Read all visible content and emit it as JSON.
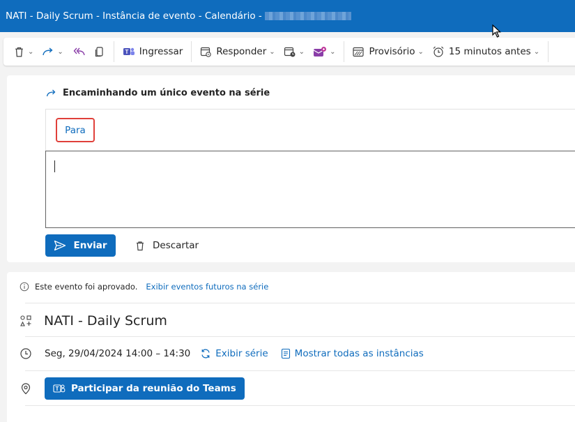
{
  "window": {
    "title": "NATI - Daily Scrum - Instância de evento - Calendário -"
  },
  "toolbar": {
    "join_label": "Ingressar",
    "respond_label": "Responder",
    "status_label": "Provisório",
    "reminder_label": "15 minutos antes"
  },
  "compose": {
    "forward_note": "Encaminhando um único evento na série",
    "to_label": "Para",
    "send_label": "Enviar",
    "discard_label": "Descartar"
  },
  "event": {
    "approved_text": "Este evento foi aprovado.",
    "future_events_link": "Exibir eventos futuros na série",
    "title": "NATI - Daily Scrum",
    "datetime": "Seg, 29/04/2024 14:00 – 14:30",
    "view_series_label": "Exibir série",
    "show_instances_label": "Mostrar todas as instâncias",
    "teams_button_label": "Participar da reunião do Teams"
  },
  "colors": {
    "accent": "#0f6cbd",
    "highlight_border": "#e0403a",
    "loop_purple": "#8a3ea8"
  },
  "icons": [
    "trash-icon",
    "forward-icon",
    "reply-all-icon",
    "copy-icon",
    "teams-icon",
    "respond-icon",
    "calendar-clock-icon",
    "loop-icon",
    "busy-status-icon",
    "alarm-icon",
    "send-icon",
    "info-icon",
    "category-icon",
    "clock-icon",
    "repeat-icon",
    "list-icon",
    "location-icon"
  ]
}
